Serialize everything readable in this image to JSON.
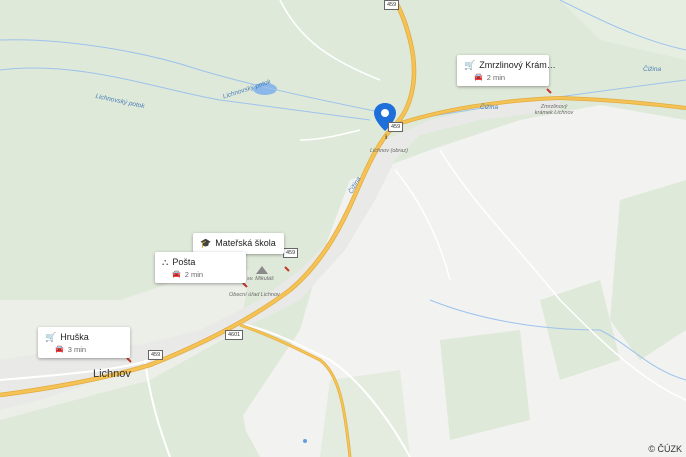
{
  "map": {
    "town": "Lichnov",
    "streams": [
      "Lichnovský potok",
      "Lichnovský potok",
      "Čižina",
      "Čižina",
      "Čižina"
    ],
    "places": [
      "Lichnov (obraz)",
      "sv. Mikuláš",
      "Obecní úřad Lichnov",
      "Zmrzlinový krámek Lichnov"
    ],
    "roads": [
      "459",
      "459",
      "459",
      "4601"
    ],
    "attribution": "© ČÚZK"
  },
  "pois": [
    {
      "name": "Zmrzlinový Krám…",
      "time": "2 min",
      "icon": "cart-icon"
    },
    {
      "name": "Mateřská škola",
      "time": "",
      "icon": "school-icon"
    },
    {
      "name": "Pošta",
      "time": "2 min",
      "icon": "post-office-icon"
    },
    {
      "name": "Hruška",
      "time": "3 min",
      "icon": "cart-icon"
    }
  ],
  "colors": {
    "forest": "#dfe9d9",
    "field": "#f2f2f1",
    "road_main": "#f4c255",
    "water": "#8bb8e8",
    "pin": "#1e6fd9"
  }
}
